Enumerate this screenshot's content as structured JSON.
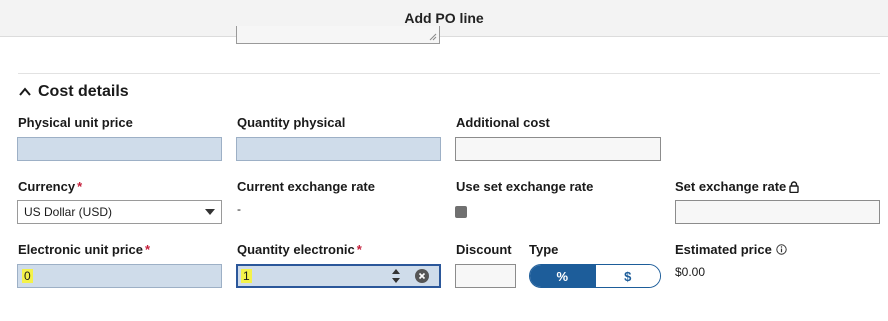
{
  "header": {
    "title": "Add PO line"
  },
  "cost_details": {
    "section_label": "Cost details",
    "physical_unit_price": {
      "label": "Physical unit price",
      "value": ""
    },
    "quantity_physical": {
      "label": "Quantity physical",
      "value": ""
    },
    "additional_cost": {
      "label": "Additional cost",
      "value": ""
    },
    "currency": {
      "label": "Currency",
      "required_mark": "*",
      "value": "US Dollar (USD)"
    },
    "current_exchange_rate": {
      "label": "Current exchange rate",
      "value": "-"
    },
    "use_set_exchange_rate": {
      "label": "Use set exchange rate",
      "checked": true
    },
    "set_exchange_rate": {
      "label": "Set exchange rate",
      "value": ""
    },
    "electronic_unit_price": {
      "label": "Electronic unit price",
      "required_mark": "*",
      "value": "0"
    },
    "quantity_electronic": {
      "label": "Quantity electronic",
      "required_mark": "*",
      "value": "1"
    },
    "discount": {
      "label": "Discount",
      "value": ""
    },
    "type": {
      "label": "Type",
      "options": [
        "%",
        "$"
      ],
      "selected": "%"
    },
    "estimated_price": {
      "label": "Estimated price",
      "value": "$0.00"
    }
  },
  "colors": {
    "accent": "#1d5d9a",
    "required": "#c41e3a",
    "field_fill": "#cfdcea",
    "highlight": "#f4f24a"
  },
  "icons": [
    "chevron-up-icon",
    "lock-icon",
    "info-icon",
    "caret-down-icon",
    "stepper-icon",
    "clear-icon",
    "resize-grip-icon"
  ]
}
